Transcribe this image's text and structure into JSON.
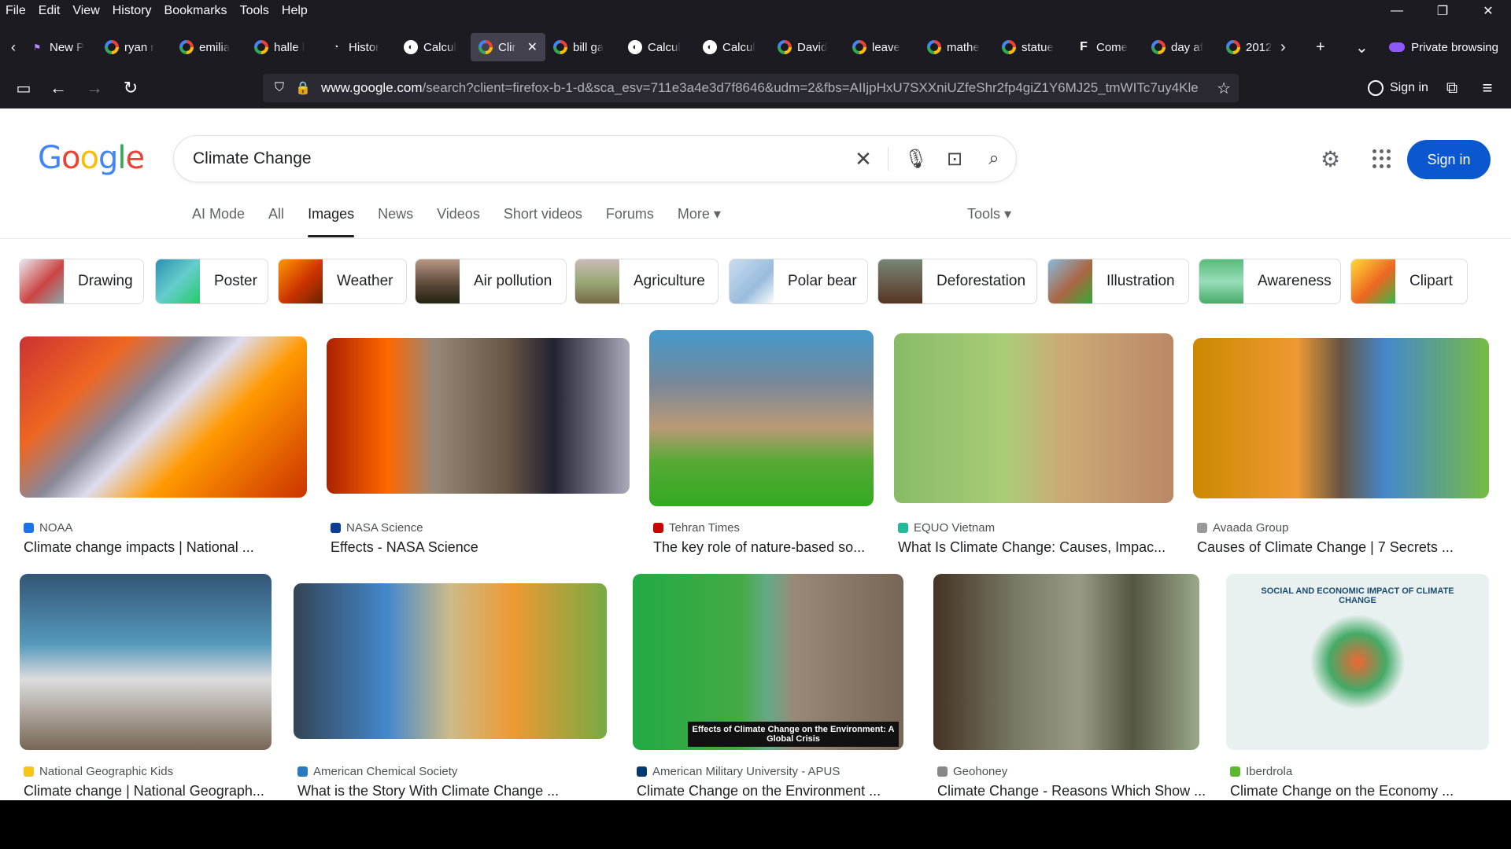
{
  "menu": [
    "File",
    "Edit",
    "View",
    "History",
    "Bookmarks",
    "Tools",
    "Help"
  ],
  "window_controls": {
    "minimize": "—",
    "maximize": "❐",
    "close": "✕"
  },
  "tabs": [
    {
      "label": "New P",
      "icon": "new"
    },
    {
      "label": "ryan r",
      "icon": "g"
    },
    {
      "label": "emilia",
      "icon": "g"
    },
    {
      "label": "halle l",
      "icon": "g"
    },
    {
      "label": "Histor",
      "icon": "hist"
    },
    {
      "label": "Calcul",
      "icon": "calc"
    },
    {
      "label": "Clir",
      "icon": "g",
      "active": true
    },
    {
      "label": "bill ga",
      "icon": "g"
    },
    {
      "label": "Calcul",
      "icon": "calc"
    },
    {
      "label": "Calcul",
      "icon": "calc"
    },
    {
      "label": "David",
      "icon": "g"
    },
    {
      "label": "leave",
      "icon": "g"
    },
    {
      "label": "mathe",
      "icon": "g"
    },
    {
      "label": "statue",
      "icon": "g"
    },
    {
      "label": "Come",
      "icon": "f"
    },
    {
      "label": "day af",
      "icon": "g"
    },
    {
      "label": "2012",
      "icon": "g"
    }
  ],
  "private_label": "Private browsing",
  "url": {
    "host": "www.google.com",
    "rest": "/search?client=firefox-b-1-d&sca_esv=711e3a4e3d7f8646&udm=2&fbs=AIIjpHxU7SXXniUZfeShr2fp4giZ1Y6MJ25_tmWITc7uy4Kle"
  },
  "nav_signin": "Sign in",
  "google": {
    "logo": [
      {
        "c": "G",
        "color": "#4285f4"
      },
      {
        "c": "o",
        "color": "#ea4335"
      },
      {
        "c": "o",
        "color": "#fbbc05"
      },
      {
        "c": "g",
        "color": "#4285f4"
      },
      {
        "c": "l",
        "color": "#34a853"
      },
      {
        "c": "e",
        "color": "#ea4335"
      }
    ],
    "query": "Climate Change",
    "signin": "Sign in",
    "tools": "Tools ▾"
  },
  "nav_tabs": [
    {
      "label": "AI Mode"
    },
    {
      "label": "All"
    },
    {
      "label": "Images",
      "active": true
    },
    {
      "label": "News"
    },
    {
      "label": "Videos"
    },
    {
      "label": "Short videos"
    },
    {
      "label": "Forums"
    },
    {
      "label": "More ▾"
    }
  ],
  "chips": [
    {
      "label": "Drawing",
      "thumb": "linear-gradient(135deg,#e8eef5,#c44 55%,#8aa)"
    },
    {
      "label": "Poster",
      "thumb": "linear-gradient(135deg,#2a8fb0,#6cc 50%,#2c6)"
    },
    {
      "label": "Weather",
      "thumb": "linear-gradient(135deg,#f90,#c30 55%,#620)"
    },
    {
      "label": "Air pollution",
      "thumb": "linear-gradient(180deg,#b98,#543 60%,#221)"
    },
    {
      "label": "Agriculture",
      "thumb": "linear-gradient(180deg,#cbb,#9a7 50%,#764)"
    },
    {
      "label": "Polar bear",
      "thumb": "linear-gradient(135deg,#cde,#9bd 60%,#fff)"
    },
    {
      "label": "Deforestation",
      "thumb": "linear-gradient(180deg,#787,#654 60%,#532)"
    },
    {
      "label": "Illustration",
      "thumb": "linear-gradient(135deg,#8bd,#a64 55%,#3a3)"
    },
    {
      "label": "Awareness",
      "thumb": "linear-gradient(180deg,#5b7,#9db 50%,#4a6)"
    },
    {
      "label": "Clipart",
      "thumb": "linear-gradient(135deg,#fd3,#e62 55%,#3b4)"
    }
  ],
  "results": [
    {
      "source": "NOAA",
      "title": "Climate change impacts | National ...",
      "fav": "#1a73e8",
      "img": "linear-gradient(135deg,#c33 0%,#e62 25%,#889 40%,#dde 50%,#f90 65%,#c30 100%)"
    },
    {
      "source": "NASA Science",
      "title": "Effects - NASA Science",
      "fav": "#0b3d91",
      "img": "linear-gradient(90deg,#a20 0%,#f60 20%,#987 35%,#654 60%,#223 75%,#aab 100%)"
    },
    {
      "source": "Tehran Times",
      "title": "The key role of nature-based so...",
      "fav": "#c00",
      "img": "linear-gradient(180deg,#49c 0%,#789 30%,#b97 55%,#5a3 75%,#3a2 100%)"
    },
    {
      "source": "EQUO Vietnam",
      "title": "What Is Climate Change: Causes, Impac...",
      "fav": "#2b9",
      "img": "linear-gradient(90deg,#8b6 0%,#ac7 40%,#ca7 60%,#b86 100%)"
    },
    {
      "source": "Avaada Group",
      "title": "Causes of Climate Change | 7 Secrets ...",
      "fav": "#999",
      "img": "linear-gradient(90deg,#c80 0%,#e93 35%,#654 50%,#48c 65%,#7b4 100%)"
    },
    {
      "source": "National Geographic Kids",
      "title": "Climate change | National Geograph...",
      "fav": "#f5c518",
      "img": "linear-gradient(180deg,#357 0%,#59b 40%,#ddd 60%,#765 100%)"
    },
    {
      "source": "American Chemical Society",
      "title": "What is the Story With Climate Change ...",
      "fav": "#2a7abf",
      "img": "linear-gradient(90deg,#345 0%,#48c 30%,#cb8 50%,#e93 70%,#7a4 100%)"
    },
    {
      "source": "American Military University - APUS",
      "title": "Climate Change on the Environment ...",
      "fav": "#003a70",
      "img": "linear-gradient(90deg,#2a4 0%,#4a4 40%,#6a8 50%,#987 60%,#765 100%)"
    },
    {
      "source": "Geohoney",
      "title": "Climate Change - Reasons Which Show ...",
      "fav": "#888",
      "img": "linear-gradient(90deg,#432 0%,#776 30%,#998 55%,#554 75%,#9a8 100%)"
    },
    {
      "source": "Iberdrola",
      "title": "Climate Change on the Economy ...",
      "fav": "#5cb82e",
      "img": "radial-gradient(circle at 50% 50%,#e63 0,#4a6 18%,#e8f0f0 30%,#e8f0f0 100%)"
    }
  ],
  "apus_caption": "Effects of Climate Change on the Environment: A Global Crisis",
  "iberdrola_caption": "SOCIAL AND ECONOMIC IMPACT OF CLIMATE CHANGE"
}
